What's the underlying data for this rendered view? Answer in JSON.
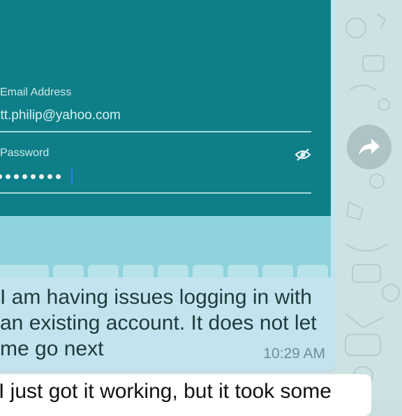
{
  "login_screenshot": {
    "email_label": "Email Address",
    "email_value": "litt.philip@yahoo.com",
    "password_label": "Password",
    "password_masked_count": 8,
    "password_visibility_icon": "eye-off-icon"
  },
  "messages": [
    {
      "direction": "outgoing",
      "text": "I am having issues logging in with an existing account. It does not let me go next",
      "time": "10:29 AM"
    },
    {
      "direction": "incoming",
      "text": "I just got it working, but it took some"
    }
  ],
  "forward_icon": "forward-arrow-icon",
  "colors": {
    "screenshot_bg": "#0e7f88",
    "outgoing_bubble": "#c3e3ee",
    "incoming_bubble": "#ffffff",
    "wallpaper": "#cfe2e3"
  }
}
